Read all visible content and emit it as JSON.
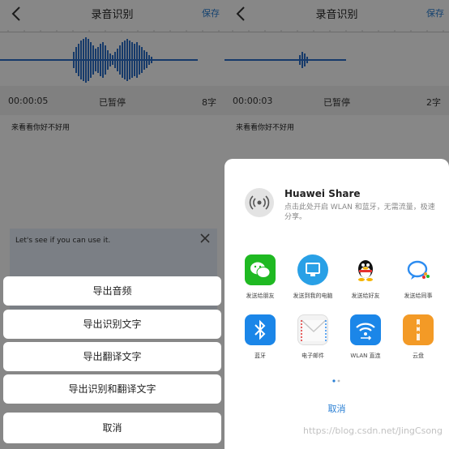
{
  "left": {
    "header": {
      "title": "录音识别",
      "save_label": "保存"
    },
    "status": {
      "time": "00:00:05",
      "state": "已暂停",
      "count": "8字"
    },
    "transcript": "来看看你好不好用",
    "translation": "Let's see if you can use it.",
    "sheet": {
      "items": [
        "导出音频",
        "导出识别文字",
        "导出翻译文字",
        "导出识别和翻译文字"
      ],
      "cancel_label": "取消"
    }
  },
  "right": {
    "header": {
      "title": "录音识别",
      "save_label": "保存"
    },
    "status": {
      "time": "00:00:03",
      "state": "已暂停",
      "count": "2字"
    },
    "transcript": "来看看你好不好用",
    "share": {
      "huawei_title": "Huawei Share",
      "huawei_desc": "点击此处开启 WLAN 和蓝牙，无需流量，极速分享。",
      "apps_row1": [
        {
          "label": "发送给朋友",
          "icon": "wechat-icon",
          "color": "#1fb922"
        },
        {
          "label": "发送到我的电脑",
          "icon": "computer-icon",
          "color": "#29a0e6"
        },
        {
          "label": "发送给好友",
          "icon": "qq-penguin-icon",
          "color": "#ffffff"
        },
        {
          "label": "发送给同事",
          "icon": "wework-icon",
          "color": "#ffffff"
        }
      ],
      "apps_row2": [
        {
          "label": "蓝牙",
          "icon": "bluetooth-icon",
          "color": "#1b86e8"
        },
        {
          "label": "电子邮件",
          "icon": "email-icon",
          "color": "#f3f3f3"
        },
        {
          "label": "WLAN 直连",
          "icon": "wifi-direct-icon",
          "color": "#1b86e8"
        },
        {
          "label": "云盘",
          "icon": "cloud-drive-icon",
          "color": "#f39a26"
        }
      ],
      "cancel_label": "取消"
    },
    "watermark": "https://blog.csdn.net/JingCsong"
  },
  "colors": {
    "accent": "#2a7fd4",
    "wave": "#2a6fc8"
  }
}
